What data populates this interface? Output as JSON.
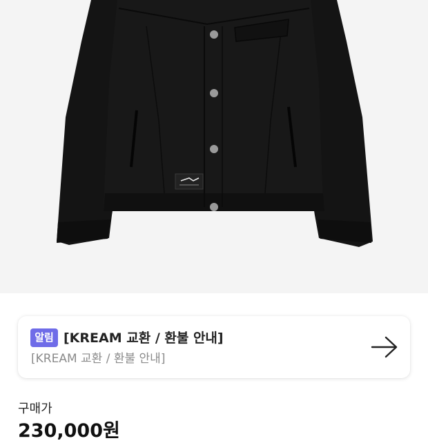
{
  "product": {
    "image_icon": "black-jacket-image",
    "label_icon": "brand-logo-icon",
    "bg_color": "#f4f4f4"
  },
  "notice": {
    "badge": "알림",
    "badge_color": "#6f6ce8",
    "title": "[KREAM 교환 / 환불 안내]",
    "subtitle": "[KREAM 교환 / 환불 안내]",
    "arrow_icon": "arrow-right-icon"
  },
  "price": {
    "label": "구매가",
    "value": "230,000원"
  }
}
